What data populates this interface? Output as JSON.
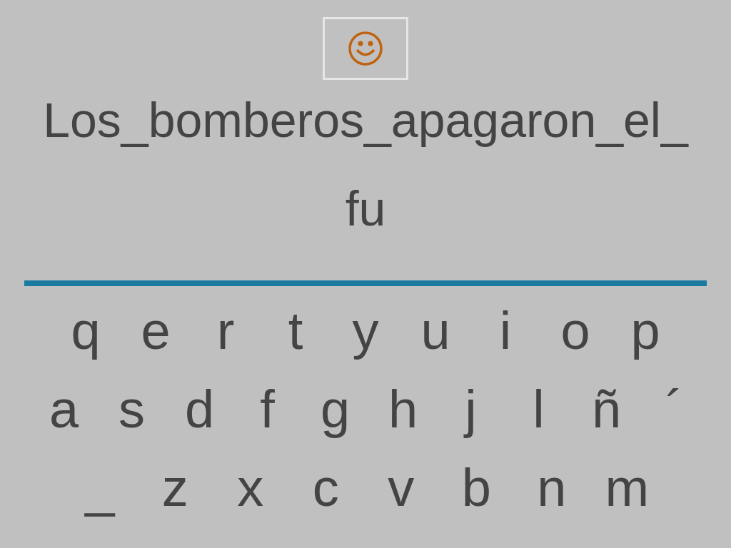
{
  "feedback": {
    "kind": "smiley"
  },
  "sentence_lines": [
    "Los_bomberos_apagaron_el_",
    "fu"
  ],
  "keyboard_rows": [
    [
      "q",
      "e",
      "r",
      "t",
      "y",
      "u",
      "i",
      "o",
      "p"
    ],
    [
      "a",
      "s",
      "d",
      "f",
      "g",
      "h",
      "j",
      "l",
      "ñ",
      "´"
    ],
    [
      "_",
      "z",
      "x",
      "c",
      "v",
      "b",
      "n",
      "m"
    ]
  ]
}
